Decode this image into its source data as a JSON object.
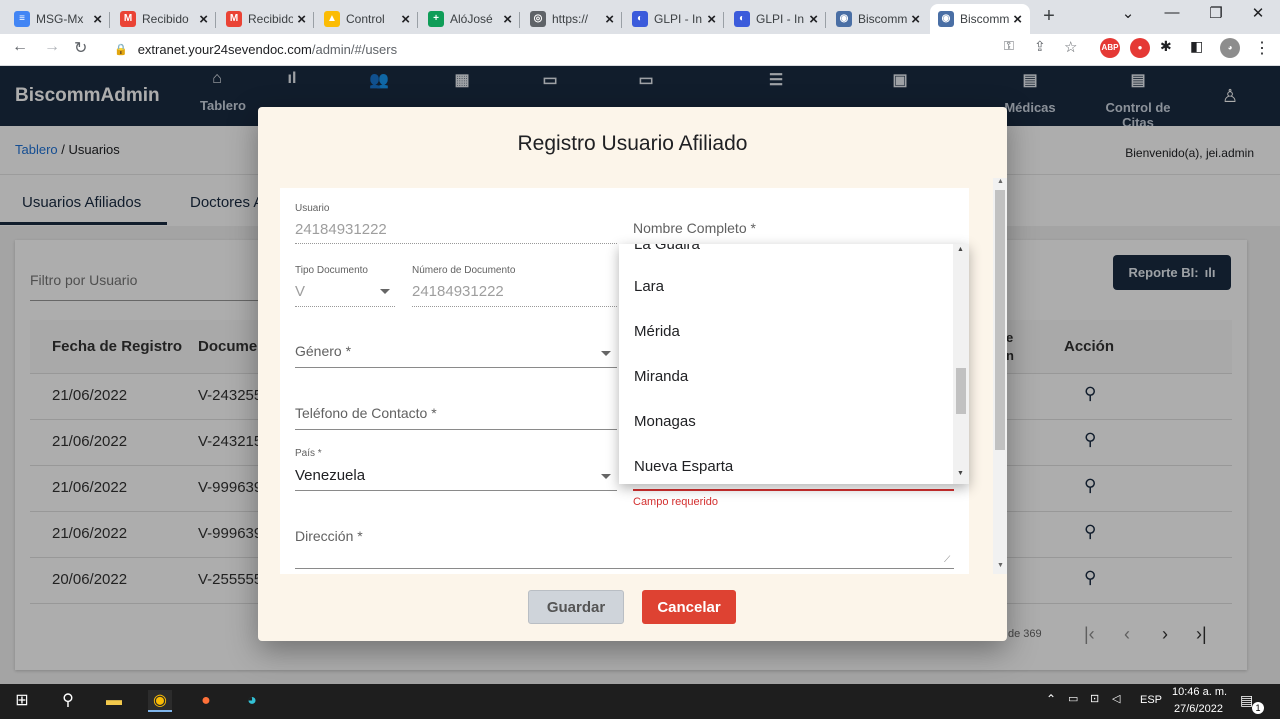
{
  "browser": {
    "tabs": [
      {
        "title": "MSG-Mx",
        "color": "#4285f4",
        "glyph": "≡"
      },
      {
        "title": "Recibido",
        "color": "#ea4335",
        "glyph": "M"
      },
      {
        "title": "Recibido",
        "color": "#ea4335",
        "glyph": "M"
      },
      {
        "title": "Control",
        "color": "#fbbc04",
        "glyph": "▲"
      },
      {
        "title": "AlóJosé",
        "color": "#0f9d58",
        "glyph": "+"
      },
      {
        "title": "https://",
        "color": "#5f6368",
        "glyph": "◎"
      },
      {
        "title": "GLPI - In",
        "color": "#3b5bdb",
        "glyph": "◐"
      },
      {
        "title": "GLPI - In",
        "color": "#3b5bdb",
        "glyph": "◐"
      },
      {
        "title": "Biscomm",
        "color": "#4a6fa5",
        "glyph": "◉"
      },
      {
        "title": "Biscomm",
        "color": "#4a6fa5",
        "glyph": "◉"
      }
    ],
    "url_domain": "extranet.your24sevendoc.com",
    "url_path": "/admin/#/users"
  },
  "app": {
    "brand": "BiscommAdmin",
    "menu": [
      "Tablero",
      "",
      "",
      "",
      "",
      "",
      "",
      "",
      "Médicas",
      "Control de Citas"
    ],
    "breadcrumb_link": "Tablero",
    "breadcrumb_current": " / Usuarios",
    "welcome": "Bienvenido(a), jei.admin",
    "tabs": [
      "Usuarios Afiliados",
      "Doctores A"
    ],
    "filter_placeholder": "Filtro por Usuario",
    "report_label": "Reporte BI:",
    "columns": [
      "Fecha de Registro",
      "Documen",
      "e",
      "n",
      "Acción"
    ],
    "rows": [
      {
        "date": "21/06/2022",
        "doc": "V-243255"
      },
      {
        "date": "21/06/2022",
        "doc": "V-243215"
      },
      {
        "date": "21/06/2022",
        "doc": "V-999639"
      },
      {
        "date": "21/06/2022",
        "doc": "V-999639"
      },
      {
        "date": "20/06/2022",
        "doc": "V-255555"
      }
    ],
    "pager_text": "de 369"
  },
  "dialog": {
    "title": "Registro Usuario Afiliado",
    "usuario_label": "Usuario",
    "usuario_value": "24184931222",
    "nombre_label": "Nombre Completo *",
    "tipo_doc_label": "Tipo Documento",
    "tipo_doc_value": "V",
    "num_doc_label": "Número de Documento",
    "num_doc_value": "24184931222",
    "genero_label": "Género *",
    "telefono_label": "Teléfono de Contacto *",
    "pais_label": "País *",
    "pais_value": "Venezuela",
    "direccion_label": "Dirección *",
    "error_text": "Campo requerido",
    "save_label": "Guardar",
    "cancel_label": "Cancelar",
    "dropdown_options": [
      "La Guaira",
      "Lara",
      "Mérida",
      "Miranda",
      "Monagas",
      "Nueva Esparta"
    ]
  },
  "taskbar": {
    "language": "ESP",
    "time": "10:46 a. m.",
    "date": "27/6/2022",
    "notifications": "1"
  }
}
